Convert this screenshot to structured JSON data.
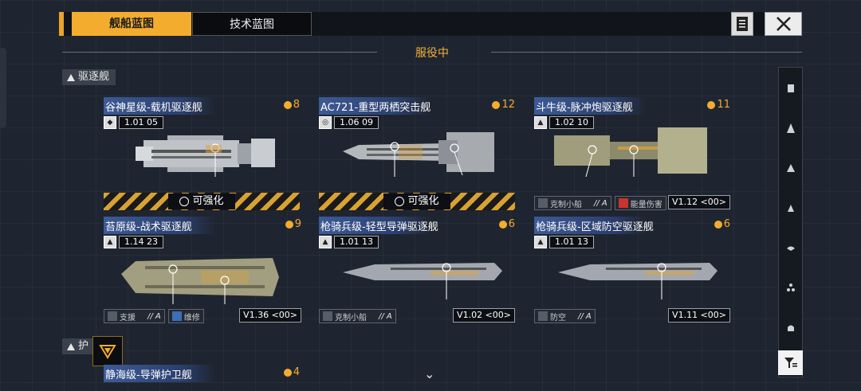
{
  "tabs": {
    "active": "舰船蓝图",
    "inactive": "技术蓝图"
  },
  "section_title": "服役中",
  "categories": {
    "destroyer": "驱逐舰",
    "frigate": "护"
  },
  "upgrade_label": "可强化",
  "ships": [
    {
      "name": "谷神星级-载机驱逐舰",
      "cost": "8",
      "level": "1.01 05",
      "upgradable": true
    },
    {
      "name": "AC721-重型两栖突击舰",
      "cost": "12",
      "level": "1.06 09",
      "upgradable": true
    },
    {
      "name": "斗牛级-脉冲炮驱逐舰",
      "cost": "11",
      "level": "1.02 10",
      "trait1": "克制小船",
      "trait1_grade": "A",
      "trait2": "能量伤害",
      "version": "V1.12 <00>"
    },
    {
      "name": "苔原级-战术驱逐舰",
      "cost": "9",
      "level": "1.14 23",
      "trait1": "支援",
      "trait1_grade": "A",
      "trait2": "维修",
      "version": "V1.36 <00>"
    },
    {
      "name": "枪骑兵级-轻型导弹驱逐舰",
      "cost": "6",
      "level": "1.01 13",
      "trait1": "克制小船",
      "trait1_grade": "A",
      "version": "V1.02 <00>"
    },
    {
      "name": "枪骑兵级-区域防空驱逐舰",
      "cost": "6",
      "level": "1.01 13",
      "trait1": "防空",
      "trait1_grade": "A",
      "version": "V1.11 <00>"
    },
    {
      "name": "静海级-导弹护卫舰",
      "cost": "4"
    }
  ],
  "icons": {
    "document": "document-icon",
    "close": "close-icon",
    "filter": "filter-icon",
    "chevron": "chevron-down-icon"
  },
  "colors": {
    "accent": "#f3ac2e",
    "title_bar": "#3d5a96"
  }
}
